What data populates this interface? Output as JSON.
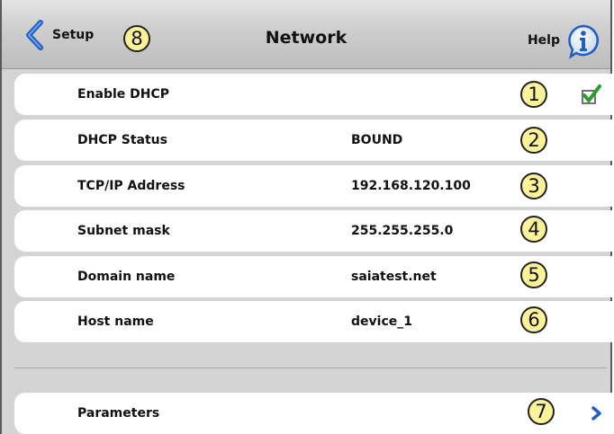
{
  "header": {
    "back_label": "Setup",
    "title": "Network",
    "help_label": "Help",
    "back_badge": "8"
  },
  "rows": [
    {
      "label": "Enable DHCP",
      "value": "",
      "badge": "1",
      "checked": true
    },
    {
      "label": "DHCP Status",
      "value": "BOUND",
      "badge": "2"
    },
    {
      "label": "TCP/IP Address",
      "value": "192.168.120.100",
      "badge": "3"
    },
    {
      "label": "Subnet mask",
      "value": "255.255.255.0",
      "badge": "4"
    },
    {
      "label": "Domain name",
      "value": "saiatest.net",
      "badge": "5"
    },
    {
      "label": "Host name",
      "value": "device_1",
      "badge": "6"
    }
  ],
  "parameters": {
    "label": "Parameters",
    "badge": "7"
  },
  "colors": {
    "accent_blue": "#1f5fc4",
    "badge_fill": "#fff39a",
    "check_green": "#2e9c2e"
  },
  "icons": [
    "back-arrow-icon",
    "info-icon",
    "checkmark-icon",
    "chevron-right-icon"
  ]
}
